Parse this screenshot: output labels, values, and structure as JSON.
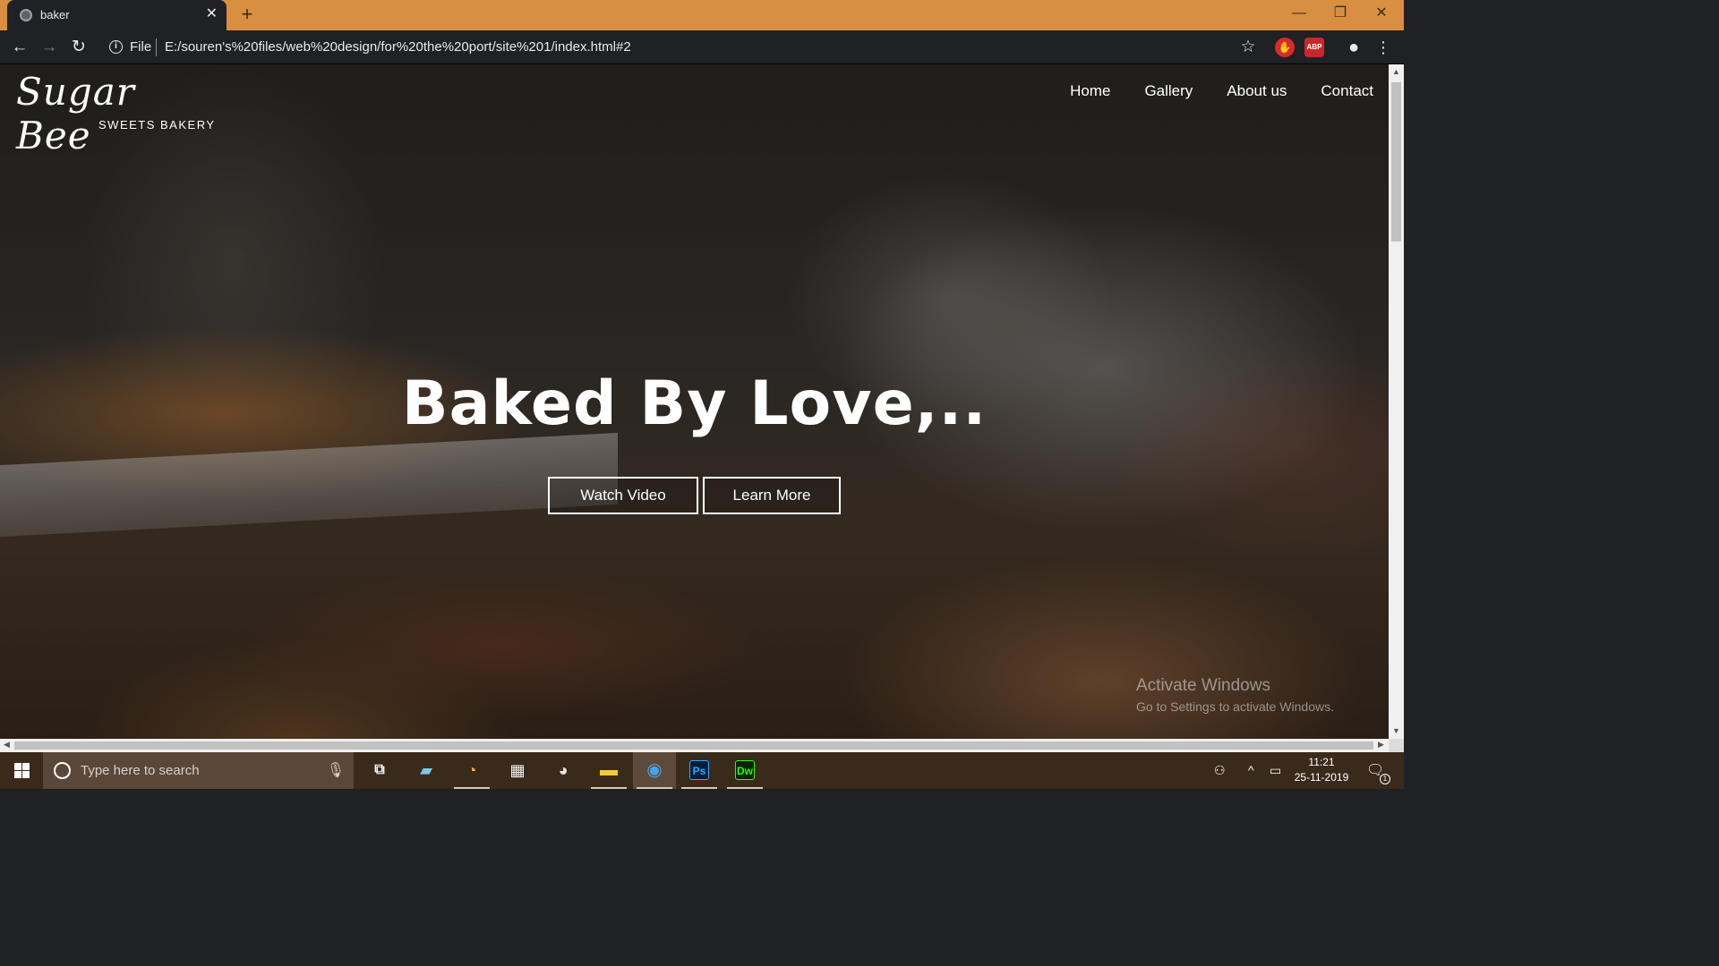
{
  "browser": {
    "tab_title": "baker",
    "tab_close": "✕",
    "new_tab": "+",
    "url_scheme_label": "File",
    "url": "E:/souren's%20files/web%20design/for%20the%20port/site%201/index.html#2",
    "window_controls": {
      "minimize": "—",
      "maximize": "❐",
      "close": "✕"
    },
    "nav": {
      "back": "←",
      "forward": "→",
      "reload": "↻"
    },
    "extensions": {
      "star": "☆",
      "ext_red": "✋",
      "abp": "ABP",
      "profile": "●",
      "menu": "⋮"
    }
  },
  "page": {
    "logo": {
      "script": "Sugar Bee",
      "sub": "SWEETS BAKERY"
    },
    "nav": [
      {
        "label": "Home"
      },
      {
        "label": "Gallery"
      },
      {
        "label": "About us"
      },
      {
        "label": "Contact"
      }
    ],
    "hero": {
      "title": "Baked By Love,..",
      "watch_video": "Watch Video",
      "learn_more": "Learn More"
    },
    "watermark": {
      "line1": "Activate Windows",
      "line2": "Go to Settings to activate Windows."
    }
  },
  "taskbar": {
    "search_placeholder": "Type here to search",
    "apps": [
      {
        "name": "task-view",
        "glyph": "⧉"
      },
      {
        "name": "notepad",
        "glyph": "▰"
      },
      {
        "name": "paint-3d",
        "glyph": "◔"
      },
      {
        "name": "microsoft-store",
        "glyph": "▦"
      },
      {
        "name": "paint",
        "glyph": "◕"
      },
      {
        "name": "file-explorer",
        "glyph": "▬"
      },
      {
        "name": "chrome",
        "glyph": "◉"
      },
      {
        "name": "photoshop",
        "glyph": "Ps"
      },
      {
        "name": "dreamweaver",
        "glyph": "Dw"
      }
    ],
    "time": "11:21",
    "date": "25-11-2019",
    "notification_count": "1"
  },
  "colors": {
    "title_bar": "#d98f42",
    "browser_dark": "#202124",
    "taskbar": "#3a2a1c",
    "photoshop": "#001e36",
    "photoshop_text": "#31a8ff",
    "dreamweaver": "#072401",
    "dreamweaver_text": "#35fa00"
  }
}
